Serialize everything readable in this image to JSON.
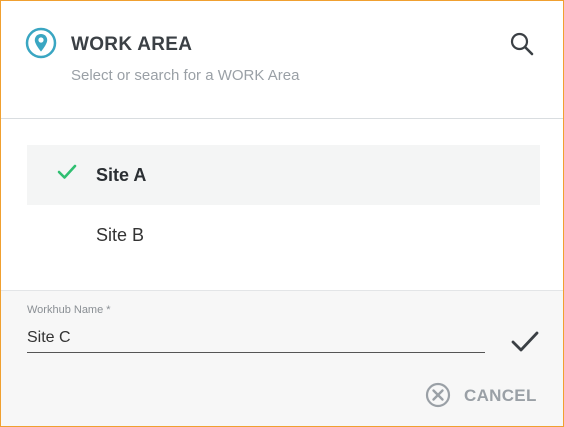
{
  "header": {
    "title": "WORK AREA",
    "subtitle": "Select or search for a WORK Area",
    "icon": "location-pin-icon",
    "search_icon": "search-icon"
  },
  "list": {
    "items": [
      {
        "label": "Site A",
        "selected": true
      },
      {
        "label": "Site B",
        "selected": false
      }
    ]
  },
  "form": {
    "field_label": "Workhub Name *",
    "field_value": "Site C",
    "confirm_icon": "checkmark-icon"
  },
  "actions": {
    "cancel_label": "CANCEL",
    "cancel_icon": "close-circle-icon"
  },
  "colors": {
    "accent_teal": "#3aa6c2",
    "check_green": "#2fbf71",
    "border_orange": "#f0a030",
    "muted_text": "#9aa0a6"
  }
}
